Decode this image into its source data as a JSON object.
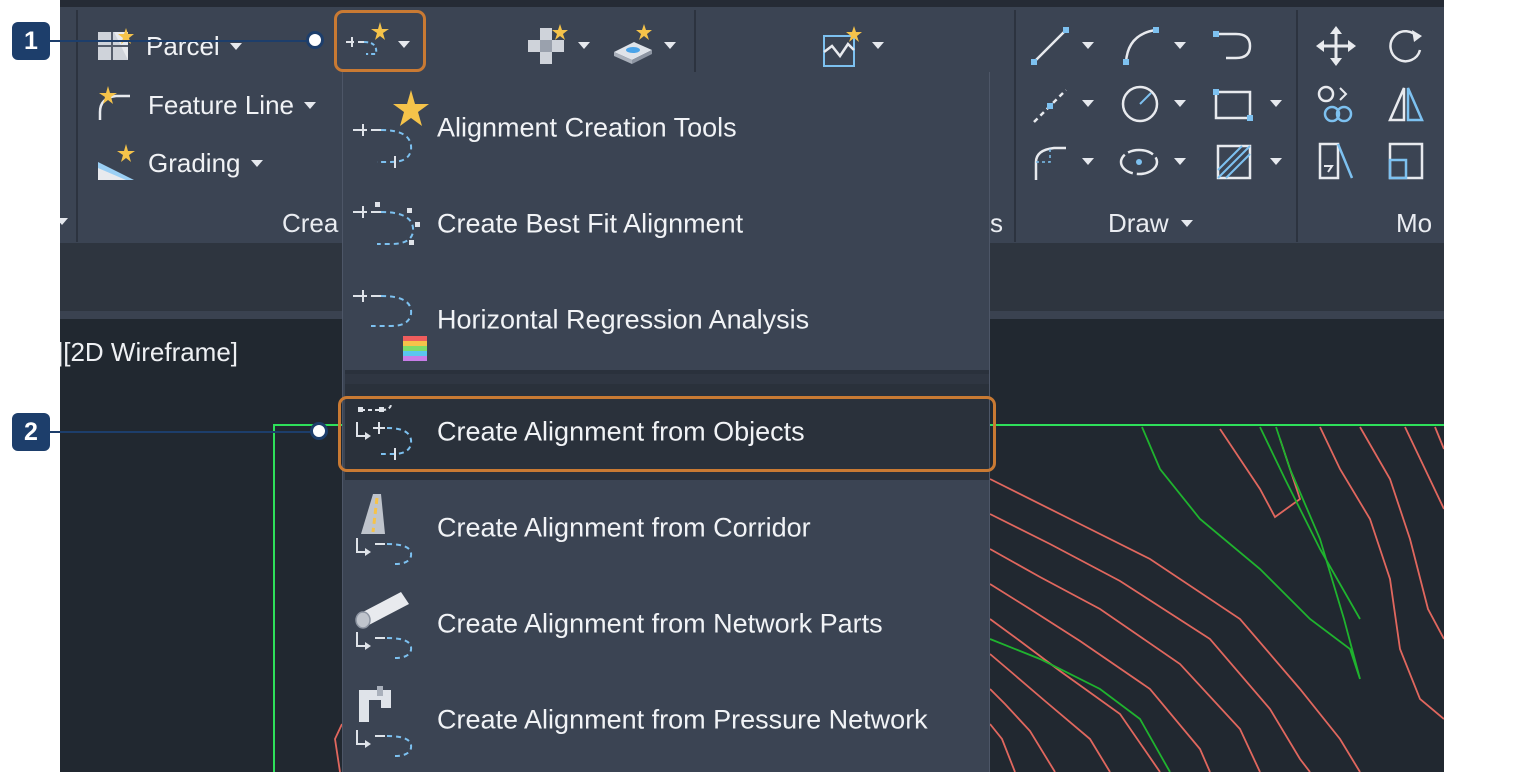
{
  "ribbon": {
    "create_panel": {
      "parcel_label": "Parcel",
      "feature_line_label": "Feature Line",
      "grading_label": "Grading",
      "title_fragment": "Crea"
    },
    "profiles_panel_title_fragment": "s",
    "draw_panel_title": "Draw",
    "modify_panel_title_fragment": "Mo"
  },
  "viewport": {
    "label": "][2D Wireframe]"
  },
  "alignment_menu": {
    "items": [
      {
        "label": "Alignment Creation Tools",
        "icon": "alignment-creation-tools-icon"
      },
      {
        "label": "Create Best Fit Alignment",
        "icon": "best-fit-alignment-icon"
      },
      {
        "label": "Horizontal Regression Analysis",
        "icon": "regression-analysis-icon"
      },
      {
        "label": "Create Alignment from Objects",
        "icon": "alignment-from-objects-icon"
      },
      {
        "label": "Create Alignment from Corridor",
        "icon": "alignment-from-corridor-icon"
      },
      {
        "label": "Create Alignment from Network Parts",
        "icon": "alignment-from-network-parts-icon"
      },
      {
        "label": "Create Alignment from Pressure Network",
        "icon": "alignment-from-pressure-network-icon"
      }
    ],
    "highlighted_index": 3
  },
  "callouts": [
    {
      "number": "1",
      "target": "alignment-dropdown-button"
    },
    {
      "number": "2",
      "target": "create-alignment-from-objects-item"
    }
  ],
  "colors": {
    "callout_blue": "#1d3e6b",
    "highlight_orange": "#c97a33",
    "ribbon_bg": "#3b4453",
    "contour_red": "#e0675e",
    "contour_green": "#1fb32e",
    "boundary_green": "#2ee05a",
    "icon_blue": "#7dc1f0",
    "sparkle_yellow": "#f5c34a"
  }
}
